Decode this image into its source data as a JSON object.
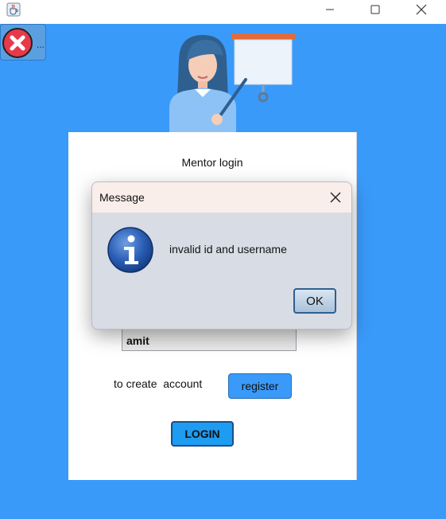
{
  "window": {
    "app_icon": "java-cup-icon",
    "controls": [
      "minimize-icon",
      "maximize-icon",
      "close-icon"
    ]
  },
  "exit_button": {
    "icon": "red-x-circle-icon",
    "label": "..."
  },
  "illustration": {
    "icon": "mentor-with-whiteboard-illustration"
  },
  "login_form": {
    "title": "Mentor login",
    "username_value": "amit",
    "create_account_text": "to create  account",
    "register_label": "register",
    "login_label": "LOGIN"
  },
  "dialog": {
    "title": "Message",
    "message": "invalid id and username",
    "ok_label": "OK",
    "icon": "information-icon"
  },
  "colors": {
    "background_blue": "#3a9afa",
    "register_blue": "#3a9afa",
    "login_blue": "#1d9cf2",
    "dialog_body": "#d8dce4",
    "dialog_header": "#f9eeea"
  }
}
